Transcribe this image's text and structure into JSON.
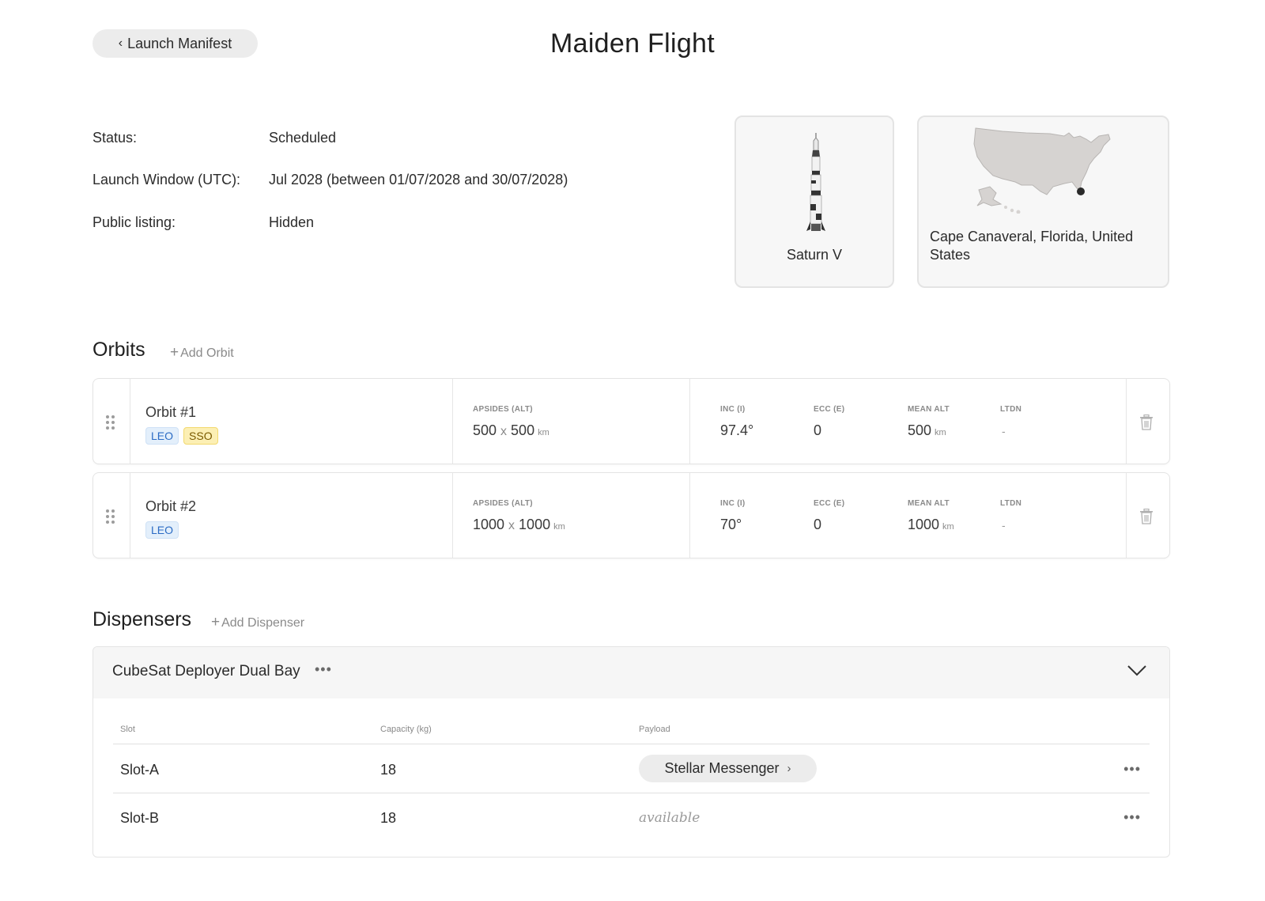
{
  "header": {
    "back_label": "Launch Manifest",
    "title": "Maiden Flight"
  },
  "info": {
    "status_label": "Status:",
    "status_value": "Scheduled",
    "window_label": "Launch Window (UTC):",
    "window_value": "Jul 2028 (between 01/07/2028 and 30/07/2028)",
    "listing_label": "Public listing:",
    "listing_value": "Hidden"
  },
  "vehicle": {
    "name": "Saturn V",
    "icon": "rocket-icon"
  },
  "site": {
    "name": "Cape Canaveral, Florida, United States",
    "icon": "us-map-icon"
  },
  "orbits": {
    "title": "Orbits",
    "add_label": "Add Orbit",
    "columns": {
      "apsides": "APSIDES (ALT)",
      "inc": "INC (I)",
      "ecc": "ECC (E)",
      "mean_alt": "MEAN ALT",
      "ltdn": "LTDN"
    },
    "unit_km": "km",
    "separator": "x",
    "items": [
      {
        "name": "Orbit #1",
        "tags": [
          "LEO",
          "SSO"
        ],
        "apo": "500",
        "peri": "500",
        "inc": "97.4°",
        "ecc": "0",
        "mean_alt": "500",
        "ltdn": "-"
      },
      {
        "name": "Orbit #2",
        "tags": [
          "LEO"
        ],
        "apo": "1000",
        "peri": "1000",
        "inc": "70°",
        "ecc": "0",
        "mean_alt": "1000",
        "ltdn": "-"
      }
    ]
  },
  "dispensers": {
    "title": "Dispensers",
    "add_label": "Add Dispenser",
    "items": [
      {
        "name": "CubeSat Deployer Dual Bay",
        "columns": {
          "slot": "Slot",
          "capacity": "Capacity (kg)",
          "payload": "Payload"
        },
        "slots": [
          {
            "slot": "Slot-A",
            "capacity": "18",
            "payload": "Stellar Messenger",
            "available": false
          },
          {
            "slot": "Slot-B",
            "capacity": "18",
            "payload": "available",
            "available": true
          }
        ]
      }
    ]
  },
  "colors": {
    "tag_leo": "#2c6cc4",
    "tag_sso": "#f2d96e",
    "card_bg": "#f7f7f7"
  }
}
